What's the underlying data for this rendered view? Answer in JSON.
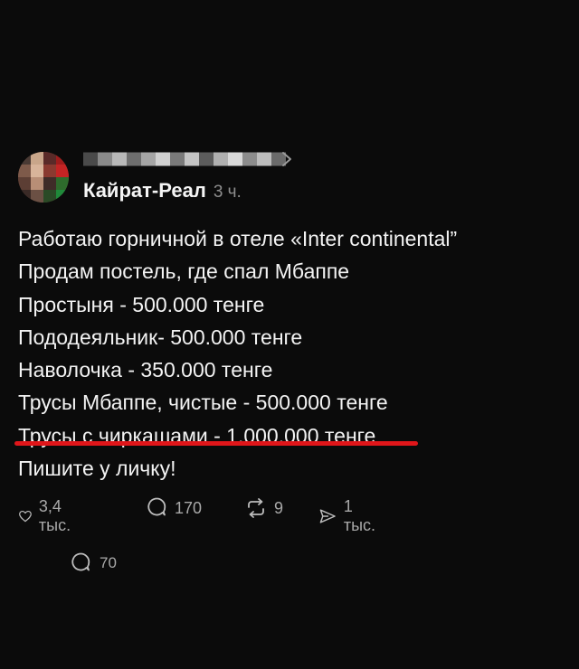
{
  "post": {
    "author": "Кайрат-Реал",
    "time": "3 ч.",
    "lines": [
      "Работаю горничной в отеле «Inter continental”",
      "Продам постель, где спал Мбаппе",
      "Простыня - 500.000 тенге",
      "Пододеяльник- 500.000 тенге",
      "Наволочка - 350.000 тенге",
      "Трусы Мбаппе, чистые - 500.000 тенге",
      "Трусы с чиркашами - 1.000.000 тенге",
      "Пишите у личку!"
    ],
    "highlight_color": "#e0161a"
  },
  "actions": {
    "likes": "3,4 тыс.",
    "comments": "170",
    "reposts": "9",
    "shares": "1 тыс."
  },
  "replies": {
    "count": "70"
  },
  "icons": [
    "avatar",
    "chevron-right-icon",
    "heart-icon",
    "comment-icon",
    "repost-icon",
    "share-icon"
  ]
}
